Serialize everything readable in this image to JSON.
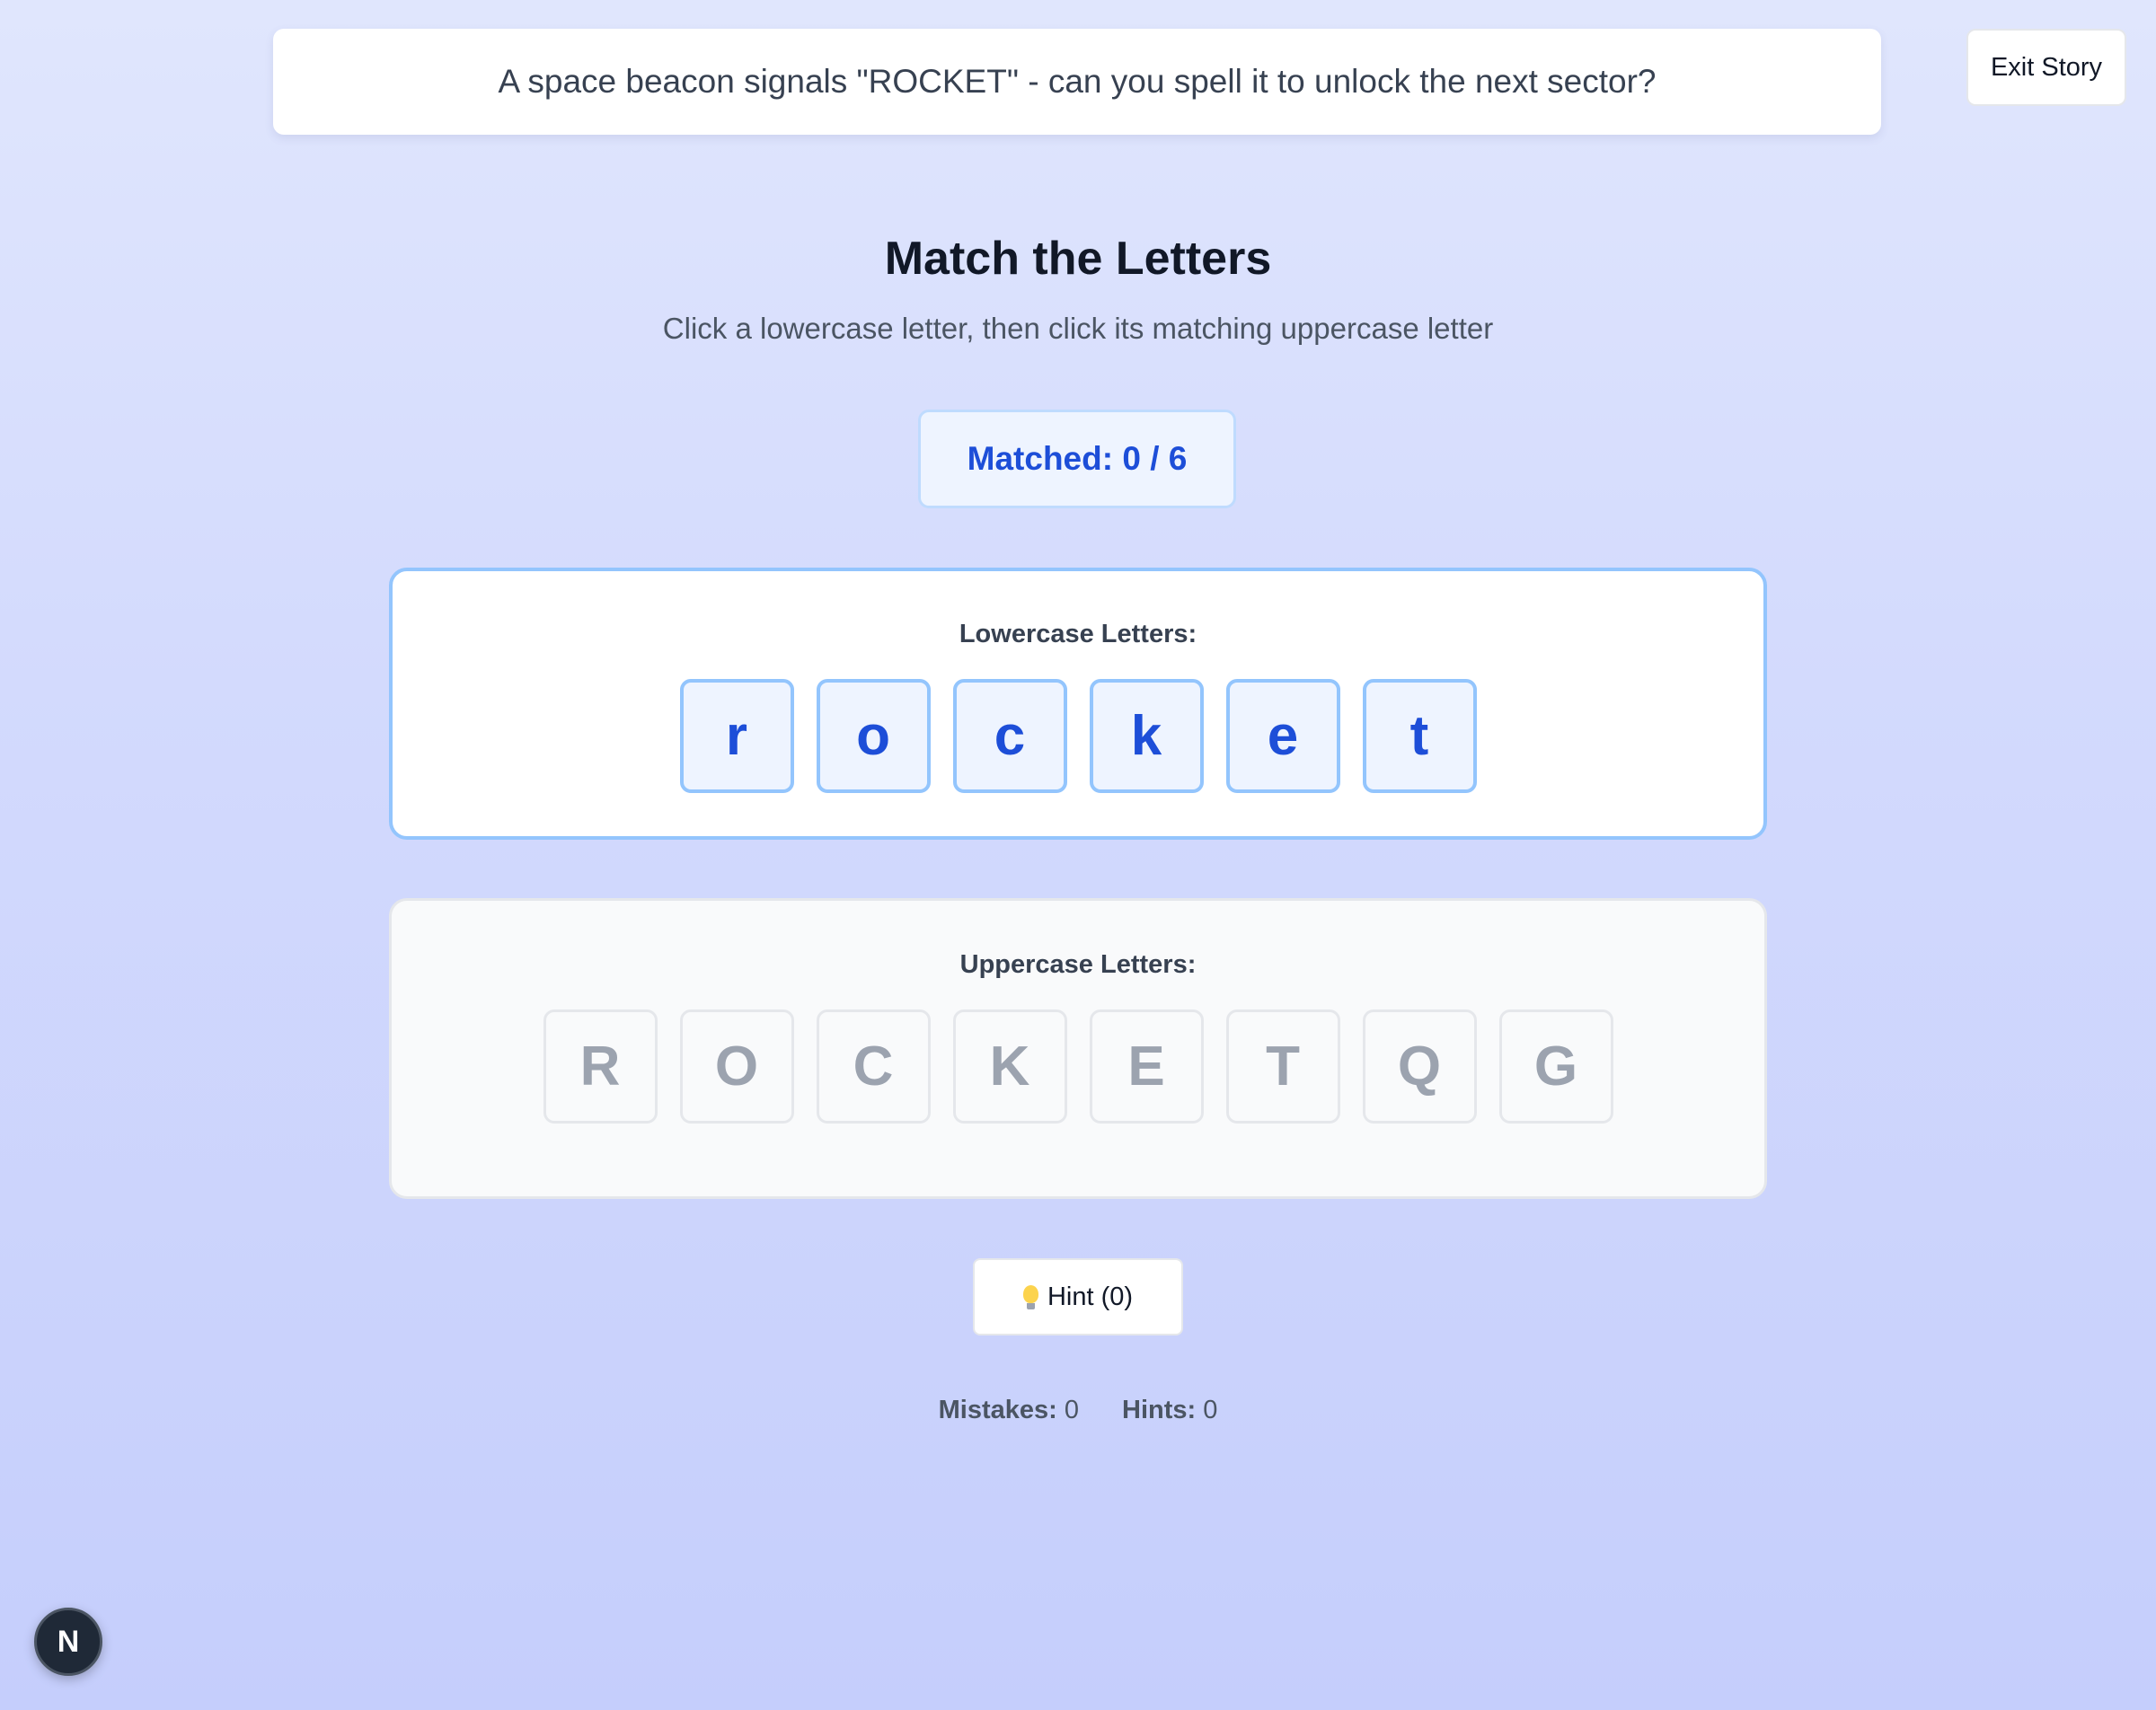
{
  "story": {
    "prompt": "A space beacon signals \"ROCKET\" - can you spell it to unlock the next sector?",
    "exit_label": "Exit Story"
  },
  "game": {
    "title": "Match the Letters",
    "instructions": "Click a lowercase letter, then click its matching uppercase letter",
    "matched_label": "Matched: 0 / 6"
  },
  "lowercase": {
    "label": "Lowercase Letters:",
    "letters": [
      "r",
      "o",
      "c",
      "k",
      "e",
      "t"
    ]
  },
  "uppercase": {
    "label": "Uppercase Letters:",
    "letters": [
      "R",
      "O",
      "C",
      "K",
      "E",
      "T",
      "Q",
      "G"
    ]
  },
  "hint": {
    "icon": "lightbulb-icon",
    "label": "Hint (0)"
  },
  "stats": {
    "mistakes_label": "Mistakes:",
    "mistakes_value": "0",
    "hints_label": "Hints:",
    "hints_value": "0"
  },
  "dev_badge": {
    "icon": "nextjs-logo-icon",
    "letter": "N"
  }
}
